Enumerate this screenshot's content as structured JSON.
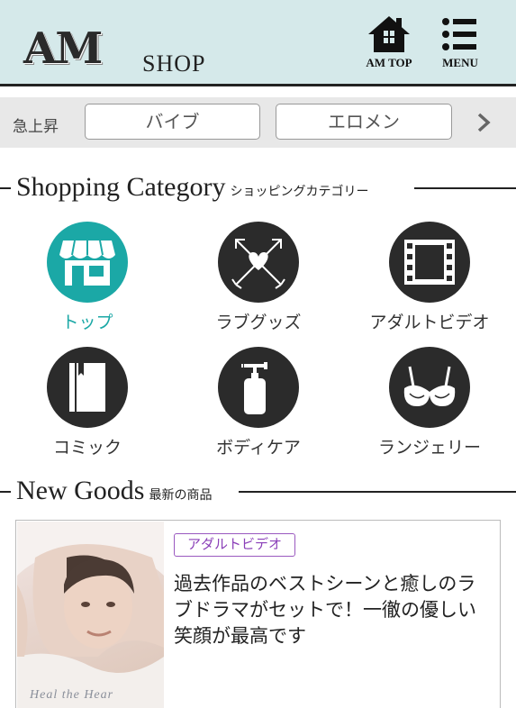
{
  "header": {
    "logo_am": "AM",
    "logo_shop": "SHOP",
    "am_top_label": "AM TOP",
    "menu_label": "MENU"
  },
  "rising": {
    "label": "急上昇",
    "keywords": [
      "バイブ",
      "エロメン"
    ]
  },
  "shopping_category": {
    "title_en": "Shopping Category",
    "title_jp": "ショッピングカテゴリー",
    "items": [
      {
        "label": "トップ",
        "icon": "shop-icon",
        "active": true
      },
      {
        "label": "ラブグッズ",
        "icon": "heart-arrows-icon",
        "active": false
      },
      {
        "label": "アダルトビデオ",
        "icon": "film-icon",
        "active": false
      },
      {
        "label": "コミック",
        "icon": "book-icon",
        "active": false
      },
      {
        "label": "ボディケア",
        "icon": "pump-bottle-icon",
        "active": false
      },
      {
        "label": "ランジェリー",
        "icon": "bra-icon",
        "active": false
      }
    ]
  },
  "new_goods": {
    "title_en": "New Goods",
    "title_jp": "最新の商品",
    "items": [
      {
        "category": "アダルトビデオ",
        "description": "過去作品のベストシーンと癒しのラブドラマがセットで！一徹の優しい笑顔が最高です",
        "image_caption": "Heal the Hear"
      }
    ]
  },
  "colors": {
    "header_bg": "#d5e9ea",
    "accent_teal": "#1ba8a6",
    "badge_purple": "#8a3fb8",
    "icon_dark": "#2b2b2b"
  }
}
